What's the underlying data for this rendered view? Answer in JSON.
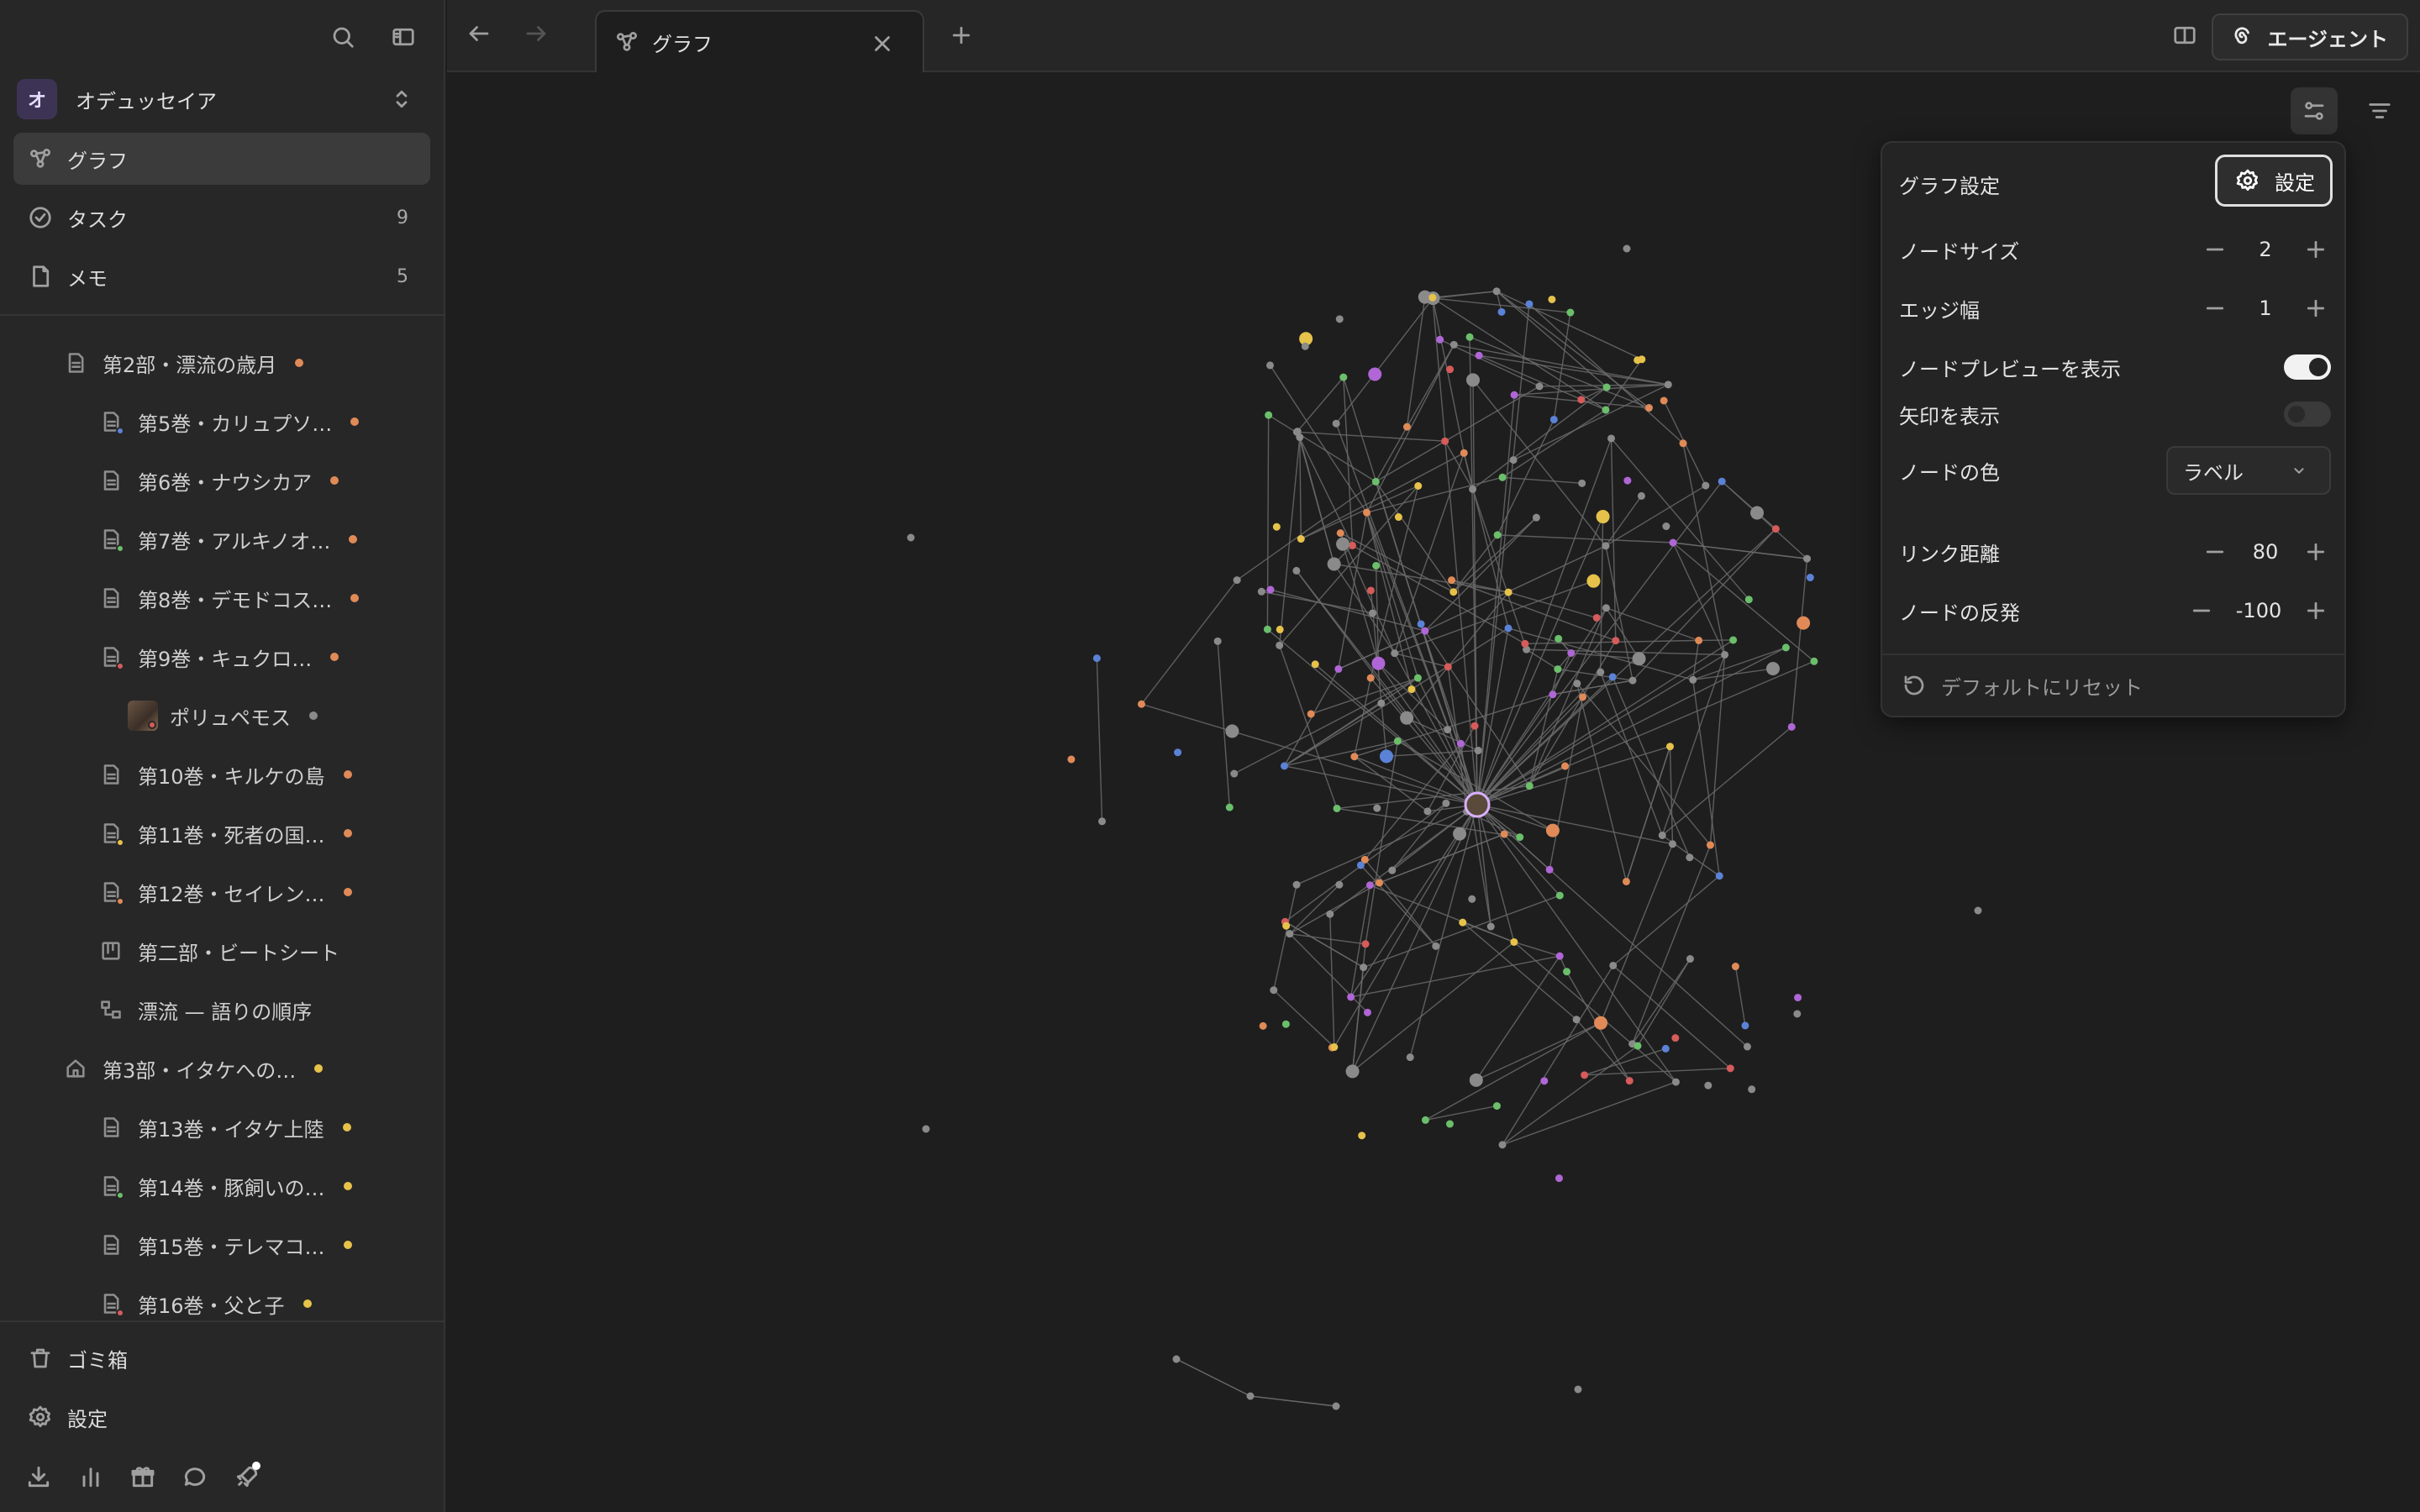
{
  "workspace": {
    "initial": "オ",
    "name": "オデュッセイア"
  },
  "nav": [
    {
      "label": "グラフ",
      "count": ""
    },
    {
      "label": "タスク",
      "count": "9"
    },
    {
      "label": "メモ",
      "count": "5"
    }
  ],
  "tree": [
    {
      "label": "第2部・漂流の歳月",
      "icon": "document-icon",
      "tag": "#e08a57"
    },
    {
      "label": "第5巻・カリュプソ…",
      "icon": "document-icon",
      "tag": "#e08a57",
      "sub": "#5b82d6"
    },
    {
      "label": "第6巻・ナウシカア",
      "icon": "document-icon",
      "tag": "#e08a57"
    },
    {
      "label": "第7巻・アルキノオ…",
      "icon": "document-icon",
      "tag": "#e08a57",
      "sub": "#6bbf6b"
    },
    {
      "label": "第8巻・デモドコス…",
      "icon": "document-icon",
      "tag": "#e08a57"
    },
    {
      "label": "第9巻・キュクロ…",
      "icon": "document-icon",
      "tag": "#e08a57",
      "sub": "#d65b5b"
    },
    {
      "label": "ポリュペモス",
      "icon": "image-thumb",
      "tag": "#8a8a8a",
      "sub": "#d65b5b"
    },
    {
      "label": "第10巻・キルケの島",
      "icon": "document-icon",
      "tag": "#e08a57"
    },
    {
      "label": "第11巻・死者の国…",
      "icon": "document-icon",
      "tag": "#e08a57",
      "sub": "#e6c24a"
    },
    {
      "label": "第12巻・セイレン…",
      "icon": "document-icon",
      "tag": "#e08a57",
      "sub": "#e08a57"
    },
    {
      "label": "第二部・ビートシート",
      "icon": "board-icon",
      "tag": ""
    },
    {
      "label": "漂流 — 語りの順序",
      "icon": "flow-icon",
      "tag": ""
    },
    {
      "label": "第3部・イタケへの…",
      "icon": "home-icon",
      "tag": "#e6c24a"
    },
    {
      "label": "第13巻・イタケ上陸",
      "icon": "document-icon",
      "tag": "#e6c24a"
    },
    {
      "label": "第14巻・豚飼いの…",
      "icon": "document-icon",
      "tag": "#e6c24a",
      "sub": "#6bbf6b"
    },
    {
      "label": "第15巻・テレマコ…",
      "icon": "document-icon",
      "tag": "#e6c24a"
    },
    {
      "label": "第16巻・父と子",
      "icon": "document-icon",
      "tag": "#e6c24a",
      "sub": "#d65b5b"
    }
  ],
  "bottom": {
    "trash": "ゴミ箱",
    "settings": "設定"
  },
  "tab": {
    "title": "グラフ"
  },
  "agent": {
    "label": "エージェント"
  },
  "panel": {
    "title": "グラフ設定",
    "settings_button": "設定",
    "node_size": {
      "label": "ノードサイズ",
      "value": "2"
    },
    "edge_width": {
      "label": "エッジ幅",
      "value": "1"
    },
    "preview": {
      "label": "ノードプレビューを表示",
      "on": true
    },
    "arrows": {
      "label": "矢印を表示",
      "on": false
    },
    "node_color": {
      "label": "ノードの色",
      "value": "ラベル"
    },
    "link_distance": {
      "label": "リンク距離",
      "value": "80"
    },
    "repulsion": {
      "label": "ノードの反発",
      "value": "-100"
    },
    "reset": "デフォルトにリセット"
  },
  "colors": {
    "accent": "#3d3455",
    "orange": "#e08a57",
    "yellow": "#e6c24a",
    "green": "#6bbf6b",
    "blue": "#5b82d6",
    "red": "#d65b5b",
    "purple": "#b066d6",
    "gray": "#8a8a8a"
  }
}
